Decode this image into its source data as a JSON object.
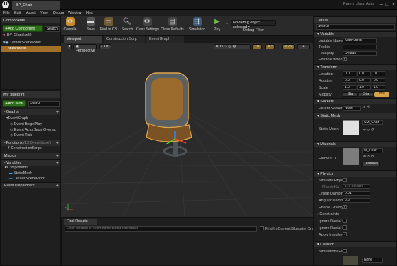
{
  "window": {
    "tab_title": "BP_Chair",
    "parent_class": "Parent class: Actor",
    "logo": "U"
  },
  "menu": [
    "File",
    "Edit",
    "Asset",
    "View",
    "Debug",
    "Window",
    "Help"
  ],
  "toolbar": {
    "buttons": [
      {
        "label": "Compile",
        "icon": "compile-icon"
      },
      {
        "label": "Save",
        "icon": "save-icon"
      },
      {
        "label": "Find in CB",
        "icon": "folder-icon"
      },
      {
        "label": "Search",
        "icon": "search-icon"
      },
      {
        "label": "Class Settings",
        "icon": "gear-icon"
      },
      {
        "label": "Class Defaults",
        "icon": "defaults-icon"
      },
      {
        "label": "Simulation",
        "icon": "simulation-icon"
      },
      {
        "label": "Play",
        "icon": "play-icon"
      }
    ],
    "debug_dropdown": "No debug object selected",
    "debug_filter": "Debug Filter"
  },
  "components": {
    "title": "Components",
    "add_button": "+Add Component",
    "search": "Search",
    "items": [
      "BP_Chair(self)",
      "DefaultSceneRoot",
      "StaticMesh"
    ]
  },
  "myblueprint": {
    "title": "My Blueprint",
    "add_new": "+Add New",
    "search_placeholder": "Search",
    "sections": {
      "graphs": "Graphs",
      "eventgraph": "EventGraph",
      "events": [
        "Event BeginPlay",
        "Event ActorBeginOverlap",
        "Event Tick"
      ],
      "functions": "Functions",
      "functions_count": "(18 Overridable)",
      "construction": "ConstructionScript",
      "macros": "Macros",
      "variables": "Variables",
      "components": "Components",
      "component_items": [
        "StaticMesh",
        "DefaultSceneRoot"
      ],
      "dispatchers": "Event Dispatchers"
    }
  },
  "tabs": [
    "Viewport",
    "Construction Scrip",
    "Event Graph"
  ],
  "viewport": {
    "perspective": "Perspective",
    "lit": "Lit",
    "snap_grid": "10",
    "snap_rot": "10°",
    "snap_scale": "0.25",
    "snap_cam": "4"
  },
  "find_results": {
    "tab": "Find Results",
    "placeholder": "Enter function or event name to find references",
    "checkbox": "Find In Current Blueprint Only"
  },
  "details": {
    "title": "Details",
    "search": "Search",
    "variable": {
      "header": "Variable",
      "name_label": "Variable Name",
      "name_value": "StaticMesh",
      "tooltip_label": "Tooltip",
      "category_label": "Category",
      "category_value": "Default",
      "editable_label": "Editable when in"
    },
    "transform": {
      "header": "Transform",
      "location": "Location",
      "rotation": "Rotation",
      "scale": "Scale",
      "loc": [
        "0.0",
        "0.0",
        "0.0"
      ],
      "rot": [
        "0.0",
        "0.0",
        "0.0"
      ],
      "scl": [
        "1.0",
        "1.0",
        "1.0"
      ],
      "mobility": "Mobility",
      "mob_opts": [
        "Sta",
        "Sta",
        "Mo"
      ]
    },
    "sockets": {
      "header": "Sockets",
      "label": "Parent Socket",
      "value": "None"
    },
    "static_mesh": {
      "header": "Static Mesh",
      "label": "Static Mesh",
      "value": "SM_Chair"
    },
    "materials": {
      "header": "Materials",
      "label": "Element 0",
      "value": "M_Chair",
      "textures": "Textures"
    },
    "physics": {
      "header": "Physics",
      "simulate": "Simulate Physic",
      "masskg": "MassInKg",
      "mass_value": "179.836884",
      "lin_damp": "Linear Damping",
      "lin_value": "0.01",
      "ang_damp": "Angular Dampin",
      "ang_value": "0.0",
      "gravity": "Enable Gravity",
      "constraints": "Constraints",
      "radial_im": "Ignore Radial Im",
      "radial_fo": "Ignore Radial Fo",
      "impulse": "Apply Impulse o"
    },
    "collision": {
      "header": "Collision",
      "sim_gen": "Simulation Gen",
      "dropdown": "None"
    }
  },
  "colors": {
    "accent": "#f2a93b",
    "green_btn": "#2f6f1c"
  }
}
